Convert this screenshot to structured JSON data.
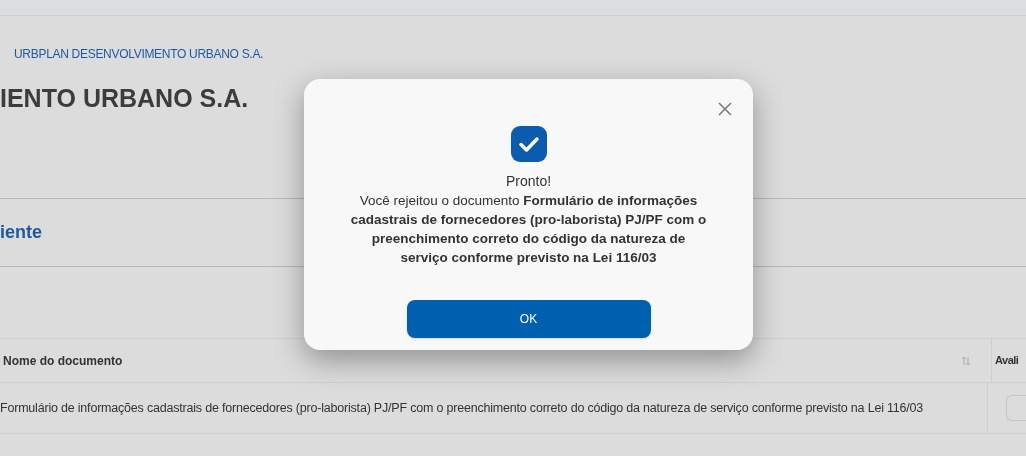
{
  "breadcrumb": {
    "current": "URBPLAN DESENVOLVIMENTO URBANO S.A."
  },
  "page_title": "IENTO URBANO S.A.",
  "section_title": "iente",
  "table": {
    "columns": [
      {
        "label": "Nome do documento",
        "sortable": true
      },
      {
        "label": "Avali",
        "sortable": false
      }
    ],
    "rows": [
      {
        "name": "Formulário de informações cadastrais de fornecedores (pro-laborista) PJ/PF com o preenchimento correto do código da natureza de serviço conforme previsto na Lei 116/03"
      }
    ]
  },
  "modal": {
    "title": "Pronto!",
    "message": "Você rejeitou o documento **Formulário de informações cadastrais de fornecedores (pro-laborista) PJ/PF com o preenchimento correto do código da natureza de serviço conforme previsto na Lei 116/03**",
    "button": "OK"
  }
}
